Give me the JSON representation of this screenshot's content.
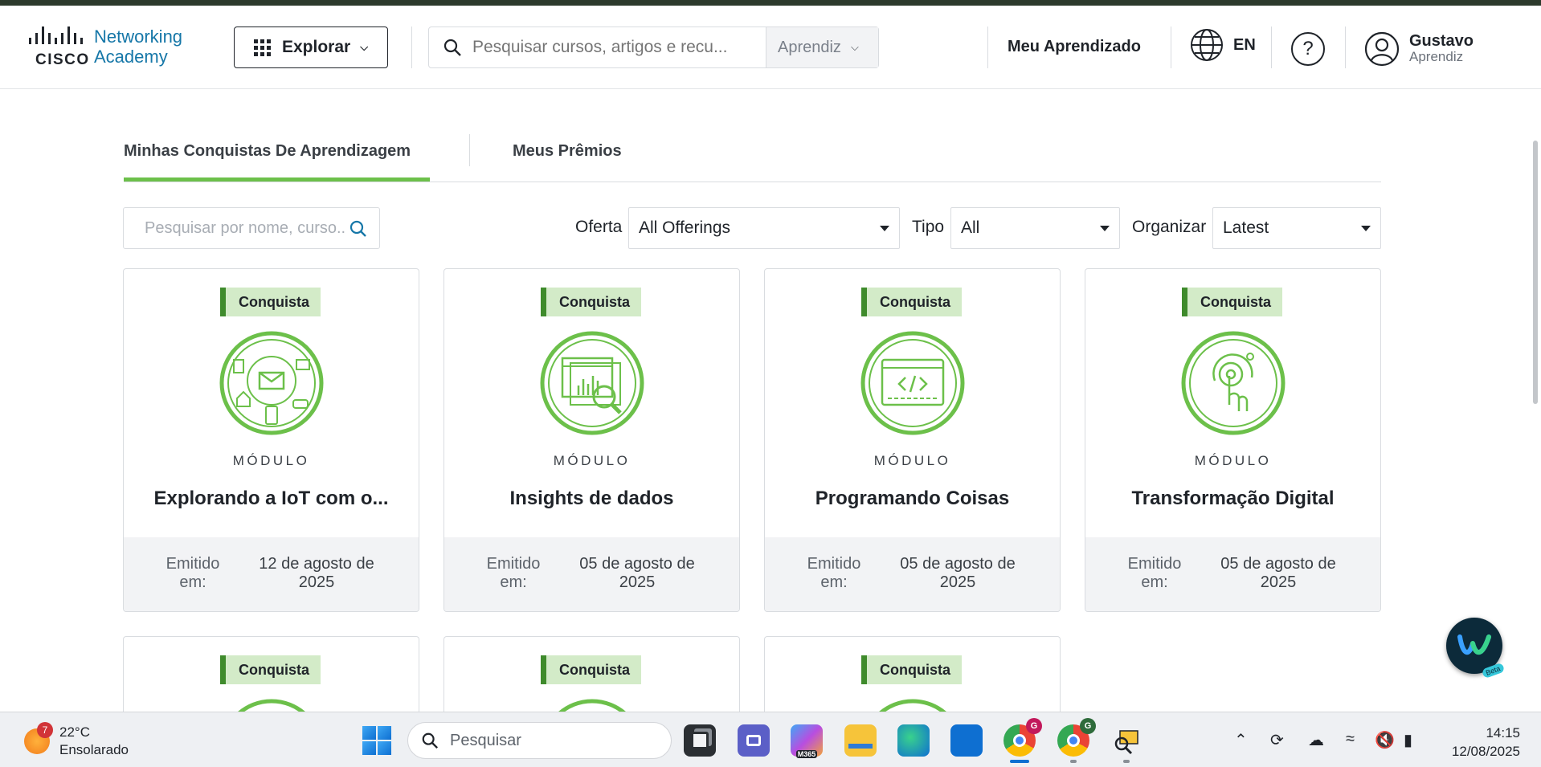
{
  "header": {
    "logo_brand": "CISCO",
    "logo_line1": "Networking",
    "logo_line2": "Academy",
    "explore_label": "Explorar",
    "search_placeholder": "Pesquisar cursos, artigos e recu...",
    "search_scope": "Aprendiz",
    "my_learning": "Meu Aprendizado",
    "language": "EN",
    "help": "?",
    "user_name": "Gustavo",
    "user_role": "Aprendiz"
  },
  "tabs": [
    {
      "label": "Minhas Conquistas De Aprendizagem",
      "active": true
    },
    {
      "label": "Meus Prêmios",
      "active": false
    }
  ],
  "filters": {
    "search_placeholder": "Pesquisar por nome, curso...",
    "offer_label": "Oferta",
    "offer_value": "All Offerings",
    "type_label": "Tipo",
    "type_value": "All",
    "sort_label": "Organizar",
    "sort_value": "Latest"
  },
  "cards": [
    {
      "badge": "Conquista",
      "kind": "MÓDULO",
      "title": "Explorando a IoT com o...",
      "issued_label": "Emitido em:",
      "issued_date": "12 de agosto de 2025",
      "icon": "iot-devices-icon"
    },
    {
      "badge": "Conquista",
      "kind": "MÓDULO",
      "title": "Insights de dados",
      "issued_label": "Emitido em:",
      "issued_date": "05 de agosto de 2025",
      "icon": "data-insights-icon"
    },
    {
      "badge": "Conquista",
      "kind": "MÓDULO",
      "title": "Programando Coisas",
      "issued_label": "Emitido em:",
      "issued_date": "05 de agosto de 2025",
      "icon": "code-window-icon"
    },
    {
      "badge": "Conquista",
      "kind": "MÓDULO",
      "title": "Transformação Digital",
      "issued_label": "Emitido em:",
      "issued_date": "05 de agosto de 2025",
      "icon": "touch-target-icon"
    }
  ],
  "partial_cards": [
    {
      "badge": "Conquista"
    },
    {
      "badge": "Conquista"
    },
    {
      "badge": "Conquista"
    }
  ],
  "floating_button": {
    "label": "Beta"
  },
  "taskbar": {
    "weather_temp": "22°C",
    "weather_desc": "Ensolarado",
    "weather_badge": "7",
    "search_label": "Pesquisar",
    "time": "14:15",
    "date": "12/08/2025",
    "apps": [
      "file-explorer-dark-icon",
      "teams-icon",
      "m365-copilot-icon",
      "folder-icon",
      "edge-icon",
      "store-icon",
      "chrome-profile-g-icon",
      "chrome-profile-g2-icon",
      "snipping-icon"
    ],
    "m365_label": "M365",
    "chrome_badge_1": "G",
    "chrome_badge_2": "G"
  },
  "colors": {
    "accent_green": "#6cc04a",
    "badge_bg": "#d3ebc8",
    "badge_bar": "#3f8b2c",
    "cisco_blue": "#1677a8"
  }
}
